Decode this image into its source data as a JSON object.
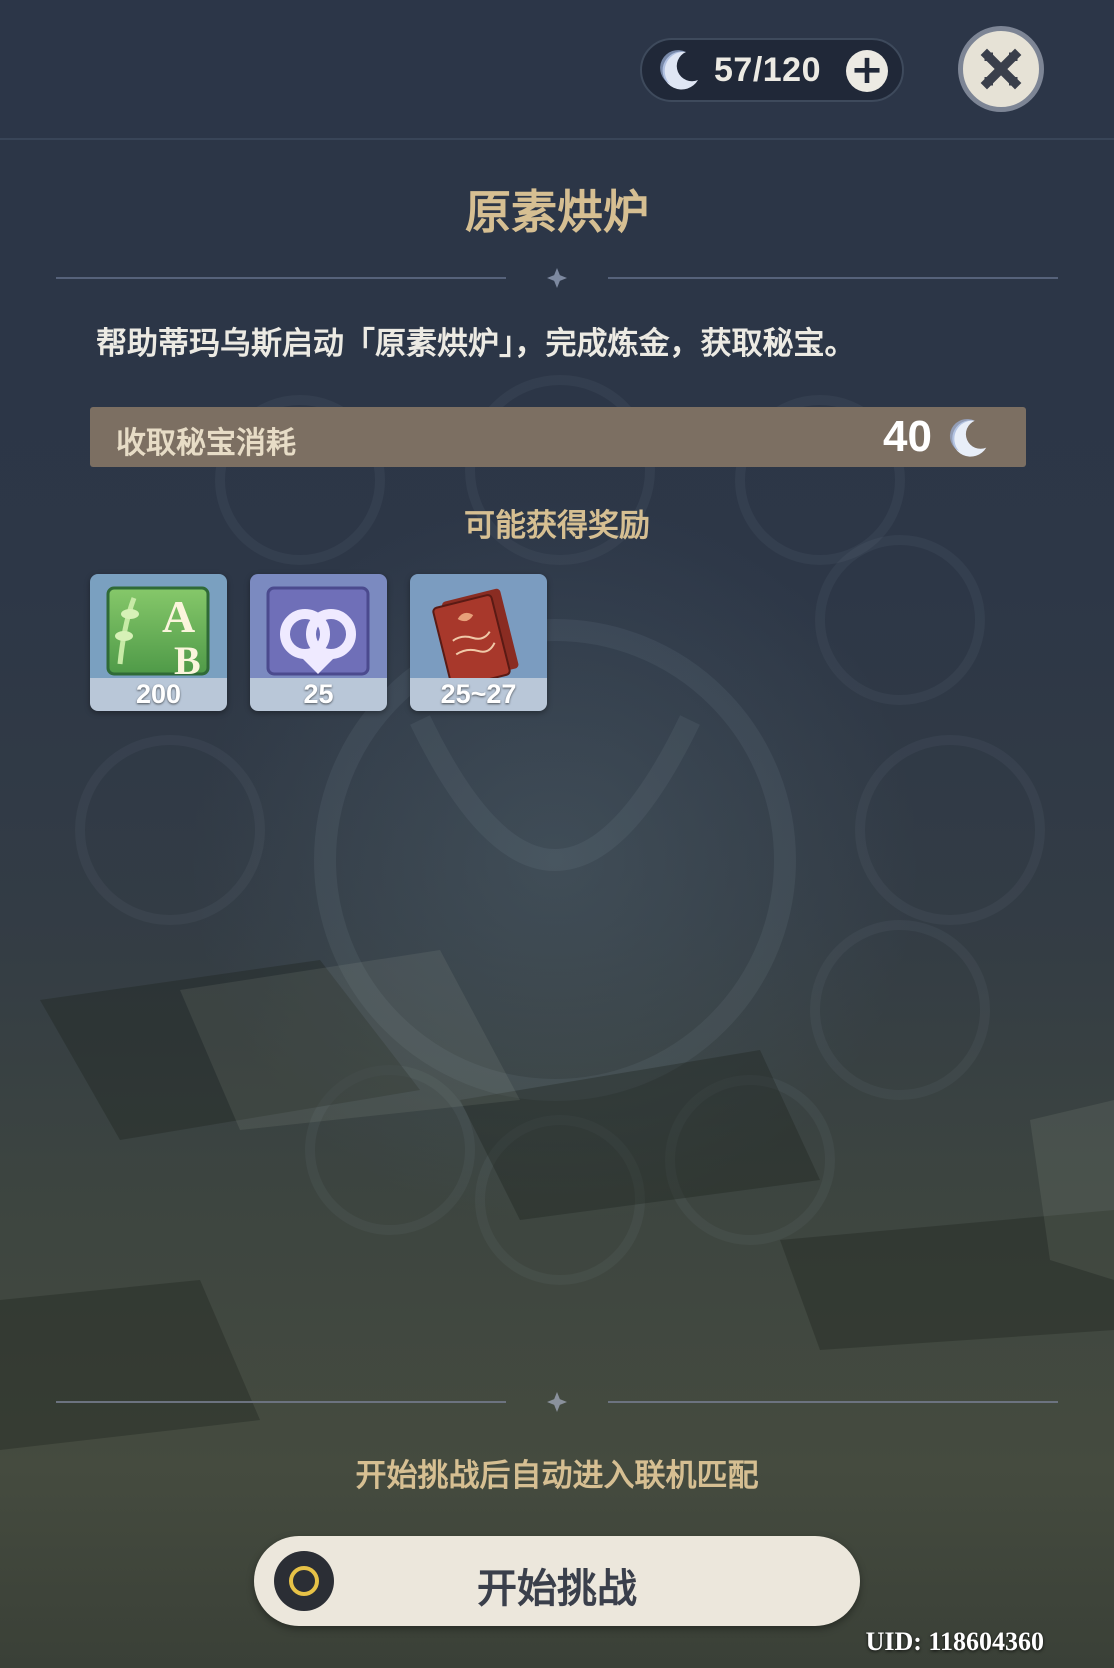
{
  "header": {
    "resin_count": "57/120",
    "add_label": "+"
  },
  "event": {
    "title": "原素烘炉",
    "description": "帮助蒂玛乌斯启动「原素烘炉」，完成炼金，获取秘宝。",
    "cost_label": "收取秘宝消耗",
    "cost_value": "40",
    "rewards_title": "可能获得奖励",
    "rewards": [
      {
        "icon": "adventure-exp-icon",
        "quantity": "200"
      },
      {
        "icon": "friendship-exp-icon",
        "quantity": "25"
      },
      {
        "icon": "character-card-icon",
        "quantity": "25~27"
      }
    ]
  },
  "footer": {
    "hint": "开始挑战后自动进入联机匹配",
    "start_label": "开始挑战",
    "uid": "UID: 118604360"
  },
  "colors": {
    "accent_gold": "#d6bf92",
    "cost_bar": "#7c6f62",
    "button_bg": "#ece7dc"
  }
}
